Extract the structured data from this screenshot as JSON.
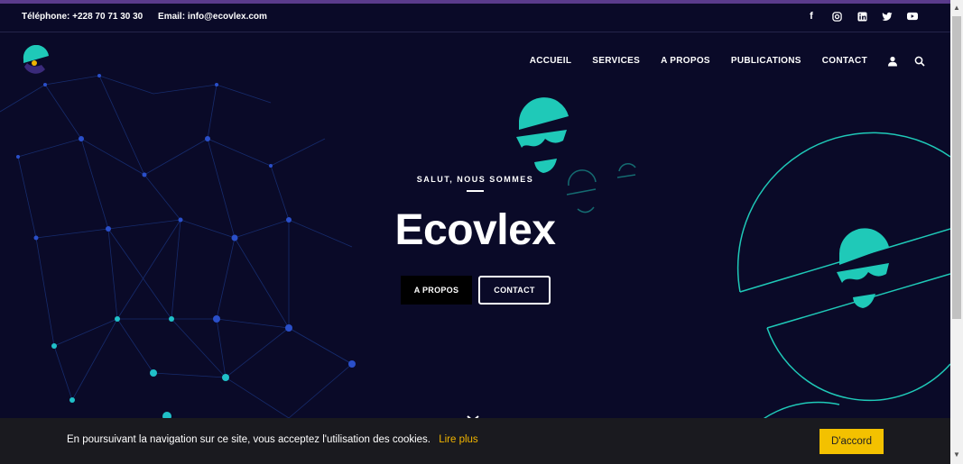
{
  "topbar": {
    "phone": "Téléphone: +228 70 71 30 30",
    "email": "Email: info@ecovlex.com",
    "social": [
      "facebook-icon",
      "instagram-icon",
      "linkedin-icon",
      "twitter-icon",
      "youtube-icon"
    ]
  },
  "nav": {
    "items": [
      "ACCUEIL",
      "SERVICES",
      "A PROPOS",
      "PUBLICATIONS",
      "CONTACT"
    ],
    "icons": [
      "user-icon",
      "search-icon"
    ]
  },
  "hero": {
    "subtitle": "SALUT, NOUS SOMMES",
    "title": "Ecovlex",
    "button_about": "A PROPOS",
    "button_contact": "CONTACT",
    "scroll_indicator": "chevron-down-icon"
  },
  "cookie": {
    "message": "En poursuivant la navigation sur ce site, vous acceptez l'utilisation des cookies.",
    "link": "Lire plus",
    "accept": "D'accord"
  },
  "colors": {
    "accent": "#1fc9b8",
    "background": "#0a0a28",
    "cookie_button": "#f3c100",
    "cookie_link": "#f0b400"
  }
}
